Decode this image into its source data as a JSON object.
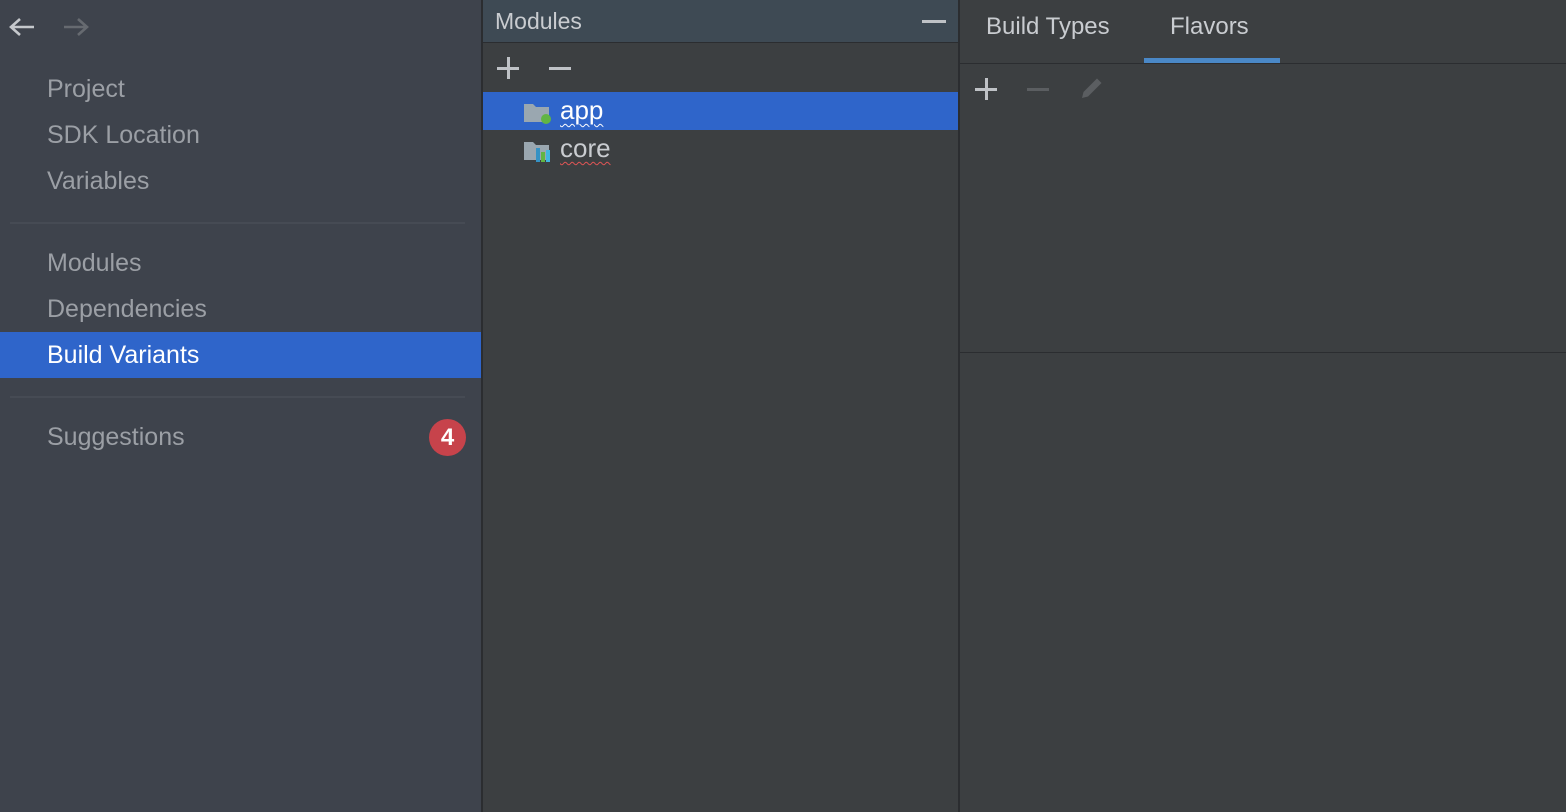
{
  "sidebar": {
    "nav_icons": {
      "back": "arrow-left-icon",
      "forward": "arrow-right-icon"
    },
    "group1": [
      {
        "label": "Project"
      },
      {
        "label": "SDK Location"
      },
      {
        "label": "Variables"
      }
    ],
    "group2": [
      {
        "label": "Modules"
      },
      {
        "label": "Dependencies"
      },
      {
        "label": "Build Variants",
        "selected": true
      }
    ],
    "group3": [
      {
        "label": "Suggestions",
        "badge": "4"
      }
    ]
  },
  "modules_panel": {
    "title": "Modules",
    "toolbar": {
      "add_icon": "plus-icon",
      "remove_icon": "minus-icon"
    },
    "items": [
      {
        "label": "app",
        "icon": "android-app-module-icon",
        "selected": true
      },
      {
        "label": "core",
        "icon": "library-module-icon",
        "selected": false
      }
    ]
  },
  "right_panel": {
    "tabs": [
      {
        "label": "Build Types",
        "active": false
      },
      {
        "label": "Flavors",
        "active": true
      }
    ],
    "toolbar": {
      "add_icon": "plus-icon",
      "remove_icon": "minus-icon",
      "edit_icon": "pencil-icon"
    }
  },
  "colors": {
    "selection": "#2f65ca",
    "badge": "#c7434b",
    "tab_underline": "#4a88c7"
  }
}
